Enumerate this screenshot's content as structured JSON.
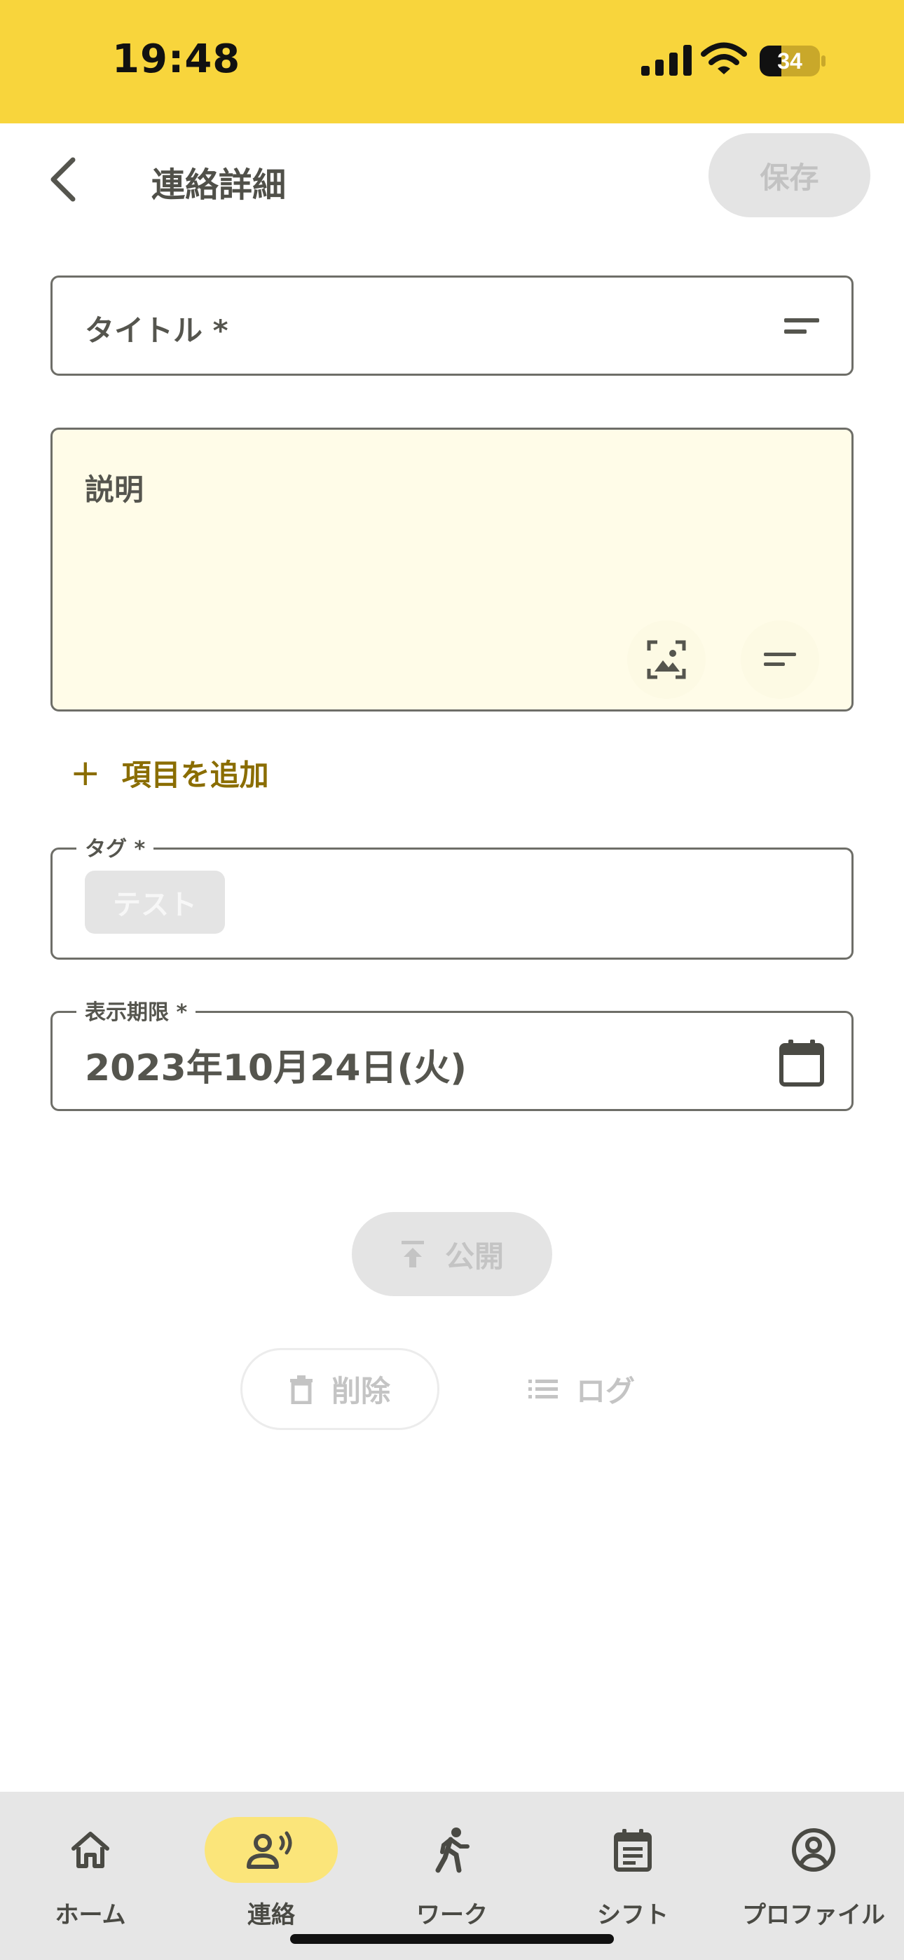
{
  "status_bar": {
    "time": "19:48",
    "battery": "34"
  },
  "header": {
    "title": "連絡詳細",
    "save_label": "保存"
  },
  "form": {
    "title_label": "タイトル *",
    "description_label": "説明",
    "add_item_label": "項目を追加",
    "tag_label": "タグ *",
    "tag_chip": "テスト",
    "expiry_label": "表示期限 *",
    "expiry_value": "2023年10月24日(火)"
  },
  "actions": {
    "publish_label": "公開",
    "delete_label": "削除",
    "log_label": "ログ"
  },
  "bottom_nav": {
    "items": [
      {
        "label": "ホーム",
        "icon": "home-icon"
      },
      {
        "label": "連絡",
        "icon": "contact-icon",
        "active": true
      },
      {
        "label": "ワーク",
        "icon": "walk-icon"
      },
      {
        "label": "シフト",
        "icon": "calendar-icon"
      },
      {
        "label": "プロファイル",
        "icon": "profile-icon"
      }
    ]
  },
  "colors": {
    "accent": "#f8d53c",
    "accent_text": "#8a6d00",
    "active_pill": "#fbe57a",
    "description_bg": "#fffce8"
  }
}
